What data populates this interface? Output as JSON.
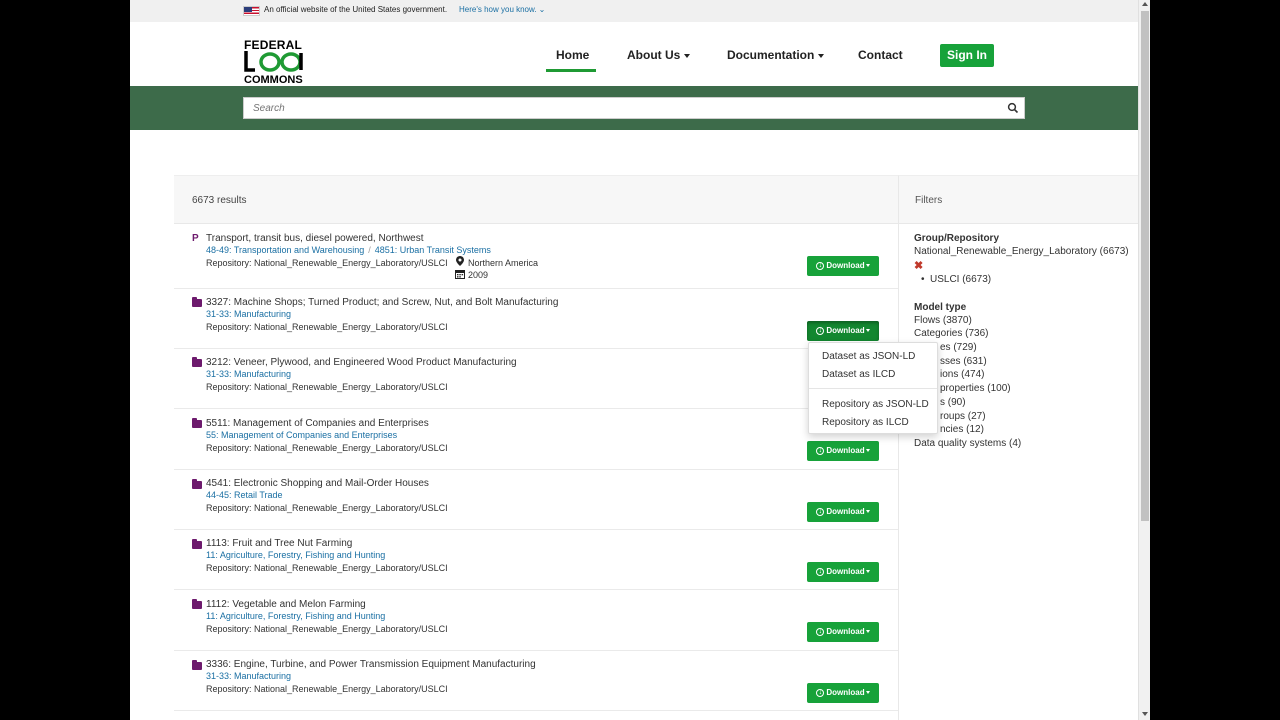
{
  "gov_banner": {
    "official": "An official website of the United States government.",
    "how_know": "Here's how you know."
  },
  "logo": {
    "line1": "FEDERAL",
    "line2": "COMMONS"
  },
  "nav": {
    "home": "Home",
    "about": "About Us",
    "documentation": "Documentation",
    "contact": "Contact",
    "sign_in": "Sign In"
  },
  "search": {
    "placeholder": "Search"
  },
  "results": {
    "count": "6673 results",
    "download_label": "Download",
    "items": [
      {
        "title": "Transport, transit bus, diesel powered, Northwest",
        "cat1": "48-49: Transportation and Warehousing",
        "cat2": "4851: Urban Transit Systems",
        "repo": "Repository: National_Renewable_Energy_Laboratory/USLCI",
        "location": "Northern America",
        "year": "2009"
      },
      {
        "title": "3327: Machine Shops; Turned Product; and Screw, Nut, and Bolt Manufacturing",
        "cat1": "31-33: Manufacturing",
        "repo": "Repository: National_Renewable_Energy_Laboratory/USLCI"
      },
      {
        "title": "3212: Veneer, Plywood, and Engineered Wood Product Manufacturing",
        "cat1": "31-33: Manufacturing",
        "repo": "Repository: National_Renewable_Energy_Laboratory/USLCI"
      },
      {
        "title": "5511: Management of Companies and Enterprises",
        "cat1": "55: Management of Companies and Enterprises",
        "repo": "Repository: National_Renewable_Energy_Laboratory/USLCI"
      },
      {
        "title": "4541: Electronic Shopping and Mail-Order Houses",
        "cat1": "44-45: Retail Trade",
        "repo": "Repository: National_Renewable_Energy_Laboratory/USLCI"
      },
      {
        "title": "1113: Fruit and Tree Nut Farming",
        "cat1": "11: Agriculture, Forestry, Fishing and Hunting",
        "repo": "Repository: National_Renewable_Energy_Laboratory/USLCI"
      },
      {
        "title": "1112: Vegetable and Melon Farming",
        "cat1": "11: Agriculture, Forestry, Fishing and Hunting",
        "repo": "Repository: National_Renewable_Energy_Laboratory/USLCI"
      },
      {
        "title": "3336: Engine, Turbine, and Power Transmission Equipment Manufacturing",
        "cat1": "31-33: Manufacturing",
        "repo": "Repository: National_Renewable_Energy_Laboratory/USLCI"
      }
    ]
  },
  "download_menu": {
    "dataset_jsonld": "Dataset as JSON-LD",
    "dataset_ilcd": "Dataset as ILCD",
    "repo_jsonld": "Repository as JSON-LD",
    "repo_ilcd": "Repository as ILCD"
  },
  "filters": {
    "title": "Filters",
    "group_heading": "Group/Repository",
    "group_value": "National_Renewable_Energy_Laboratory (6673)",
    "sub_value": "USLCI (6673)",
    "model_heading": "Model type",
    "model_items": [
      "Flows (3870)",
      "Categories (736)",
      "es (729)",
      "sses (631)",
      "ions (474)",
      "properties (100)",
      "s (90)",
      "roups (27)",
      "ncies (12)",
      "Data quality systems (4)"
    ]
  },
  "colors": {
    "accent_green": "#17a23a",
    "band_green": "#3d6b4a",
    "link_blue": "#1a6fa3",
    "folder_purple": "#6d1a6d"
  }
}
